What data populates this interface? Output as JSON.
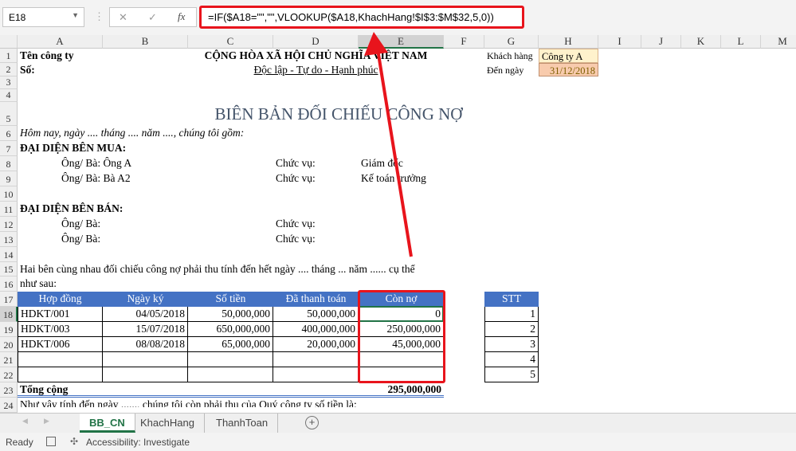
{
  "formula_bar": {
    "name_box": "E18",
    "cancel_icon": "✕",
    "enter_icon": "✓",
    "fx_label": "fx",
    "formula": "=IF($A18=\"\",\"\",VLOOKUP($A18,KhachHang!$I$3:$M$32,5,0))"
  },
  "columns": [
    "A",
    "B",
    "C",
    "D",
    "E",
    "F",
    "G",
    "H",
    "I",
    "J",
    "K",
    "L",
    "M"
  ],
  "rows": [
    "1",
    "2",
    "3",
    "4",
    "5",
    "6",
    "7",
    "8",
    "9",
    "10",
    "11",
    "12",
    "13",
    "14",
    "15",
    "16",
    "17",
    "18",
    "19",
    "20",
    "21",
    "22",
    "23",
    "24"
  ],
  "header": {
    "company": "Tên công ty",
    "so": "Số:",
    "nation": "CỘNG HÒA XÃ HỘI CHỦ NGHĨA VIỆT NAM",
    "motto": "Độc lập - Tự do - Hạnh phúc",
    "customer_label": "Khách hàng",
    "customer_value": "Công ty A",
    "date_label": "Đến ngày",
    "date_value": "31/12/2018"
  },
  "doc": {
    "title": "BIÊN BẢN ĐỐI CHIẾU CÔNG NỢ",
    "intro": "Hôm nay, ngày .... tháng .... năm ...., chúng tôi gồm:",
    "buyer_heading": "ĐẠI DIỆN BÊN MUA:",
    "buyer1": "Ông/ Bà: Ông A",
    "buyer1_role_label": "Chức vụ:",
    "buyer1_role": "Giám đốc",
    "buyer2": "Ông/ Bà: Bà A2",
    "buyer2_role_label": "Chức vụ:",
    "buyer2_role": "Kế toán trưởng",
    "seller_heading": "ĐẠI DIỆN BÊN BÁN:",
    "seller1": "Ông/ Bà:",
    "seller1_role_label": "Chức vụ:",
    "seller2": "Ông/ Bà:",
    "seller2_role_label": "Chức vụ:",
    "para1": "Hai bên cùng nhau đối chiếu công nợ phải thu tính đến hết ngày .... tháng ... năm ...... cụ thể",
    "para2": "như sau:",
    "row24": "Như vậy tính đến ngày ......, chúng tôi còn phải thu của Quý công ty số tiền là:"
  },
  "table": {
    "headers": [
      "Hợp đồng",
      "Ngày ký",
      "Số tiền",
      "Đã thanh toán",
      "Còn nợ"
    ],
    "rows": [
      [
        "HDKT/001",
        "04/05/2018",
        "50,000,000",
        "50,000,000",
        "0"
      ],
      [
        "HDKT/003",
        "15/07/2018",
        "650,000,000",
        "400,000,000",
        "250,000,000"
      ],
      [
        "HDKT/006",
        "08/08/2018",
        "65,000,000",
        "20,000,000",
        "45,000,000"
      ],
      [
        "",
        "",
        "",
        "",
        ""
      ],
      [
        "",
        "",
        "",
        "",
        ""
      ]
    ],
    "total_label": "Tổng cộng",
    "total_value": "295,000,000"
  },
  "stt": {
    "header": "STT",
    "values": [
      "1",
      "2",
      "3",
      "4",
      "5"
    ]
  },
  "sheet_tabs": {
    "nav_prev": "◀",
    "nav_next": "▶",
    "tabs": [
      "BB_CN",
      "KhachHang",
      "ThanhToan"
    ],
    "add": "+"
  },
  "status": {
    "ready": "Ready",
    "accessibility": "Accessibility: Investigate"
  },
  "colors": {
    "accent": "#217346",
    "table_header": "#4472c4",
    "highlight": "#e8141c"
  }
}
